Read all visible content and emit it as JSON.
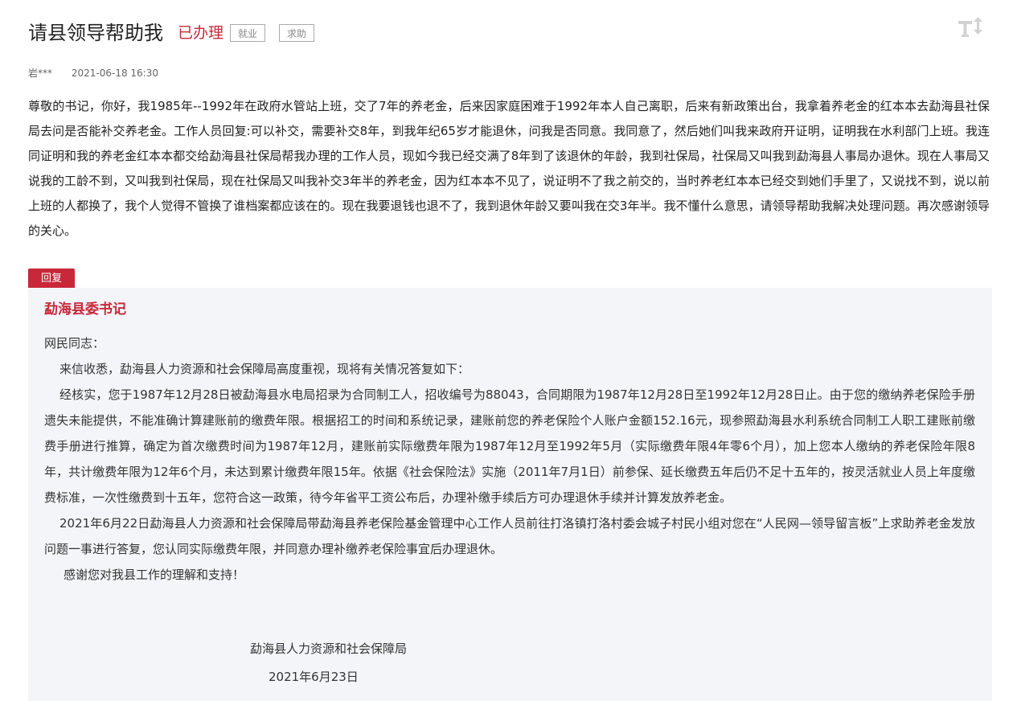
{
  "header": {
    "title": "请县领导帮助我",
    "status": "已办理",
    "tags": [
      "就业",
      "求助"
    ],
    "font_toggle_icon": "text-size-icon"
  },
  "meta": {
    "author": "岩***",
    "date": "2021-06-18 16:30"
  },
  "message": {
    "text": "尊敬的书记，你好，我1985年--1992年在政府水管站上班，交了7年的养老金，后来因家庭困难于1992年本人自己离职，后来有新政策出台，我拿着养老金的红本本去勐海县社保局去问是否能补交养老金。工作人员回复:可以补交，需要补交8年，到我年纪65岁才能退休，问我是否同意。我同意了，然后她们叫我来政府开证明，证明我在水利部门上班。我连同证明和我的养老金红本本都交给勐海县社保局帮我办理的工作人员，现如今我已经交满了8年到了该退休的年龄，我到社保局，社保局又叫我到勐海县人事局办退休。现在人事局又说我的工龄不到，又叫我到社保局，现在社保局又叫我补交3年半的养老金，因为红本本不见了，说证明不了我之前交的，当时养老红本本已经交到她们手里了，又说找不到，说以前上班的人都换了，我个人觉得不管换了谁档案都应该在的。现在我要退钱也退不了，我到退休年龄又要叫我在交3年半。我不懂什么意思，请领导帮助我解决处理问题。再次感谢领导的关心。"
  },
  "reply": {
    "badge": "回复",
    "author": "勐海县委书记",
    "greeting": "网民同志：",
    "paragraphs": [
      "来信收悉，勐海县人力资源和社会保障局高度重视，现将有关情况答复如下：",
      "经核实，您于1987年12月28日被勐海县水电局招录为合同制工人，招收编号为88043，合同期限为1987年12月28日至1992年12月28日止。由于您的缴纳养老保险手册遗失未能提供，不能准确计算建账前的缴费年限。根据招工的时间和系统记录，建账前您的养老保险个人账户金额152.16元，现参照勐海县水利系统合同制工人职工建账前缴费手册进行推算，确定为首次缴费时间为1987年12月，建账前实际缴费年限为1987年12月至1992年5月（实际缴费年限4年零6个月），加上您本人缴纳的养老保险年限8年，共计缴费年限为12年6个月，未达到累计缴费年限15年。依据《社会保险法》实施（2011年7月1日）前参保、延长缴费五年后仍不足十五年的，按灵活就业人员上年度缴费标准，一次性缴费到十五年，您符合这一政策，待今年省平工资公布后，办理补缴手续后方可办理退休手续并计算发放养老金。",
      "2021年6月22日勐海县人力资源和社会保障局带勐海县养老保险基金管理中心工作人员前往打洛镇打洛村委会城子村民小组对您在“人民网—领导留言板”上求助养老金发放问题一事进行答复，您认同实际缴费年限，并同意办理补缴养老保险事宜后办理退休。"
    ],
    "thanks": "感谢您对我县工作的理解和支持！",
    "signature_org": "勐海县人力资源和社会保障局",
    "signature_date": "2021年6月23日"
  },
  "colors": {
    "accent": "#c8283a",
    "reply_background": "#f4f5f8"
  }
}
